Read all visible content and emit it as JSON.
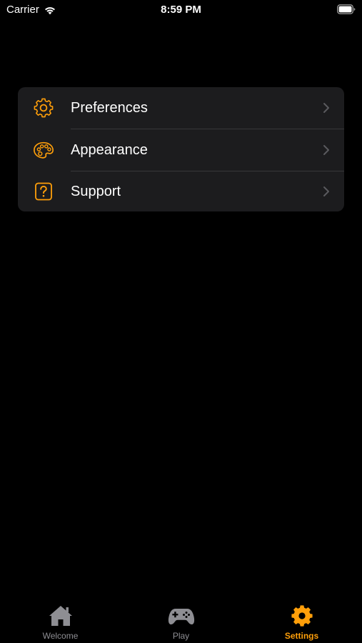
{
  "status_bar": {
    "carrier": "Carrier",
    "time": "8:59 PM",
    "icons": [
      "wifi-icon",
      "battery-icon"
    ]
  },
  "settings": {
    "accent_color": "#ff9f0a",
    "items": [
      {
        "label": "Preferences",
        "icon": "gear-outline-icon"
      },
      {
        "label": "Appearance",
        "icon": "palette-icon"
      },
      {
        "label": "Support",
        "icon": "question-square-icon"
      }
    ]
  },
  "tab_bar": {
    "tabs": [
      {
        "label": "Welcome",
        "icon": "house-icon",
        "selected": false
      },
      {
        "label": "Play",
        "icon": "gamecontroller-icon",
        "selected": false
      },
      {
        "label": "Settings",
        "icon": "gear-icon",
        "selected": true
      }
    ],
    "active_color": "#ff9f0a",
    "inactive_color": "#8e8e93"
  }
}
